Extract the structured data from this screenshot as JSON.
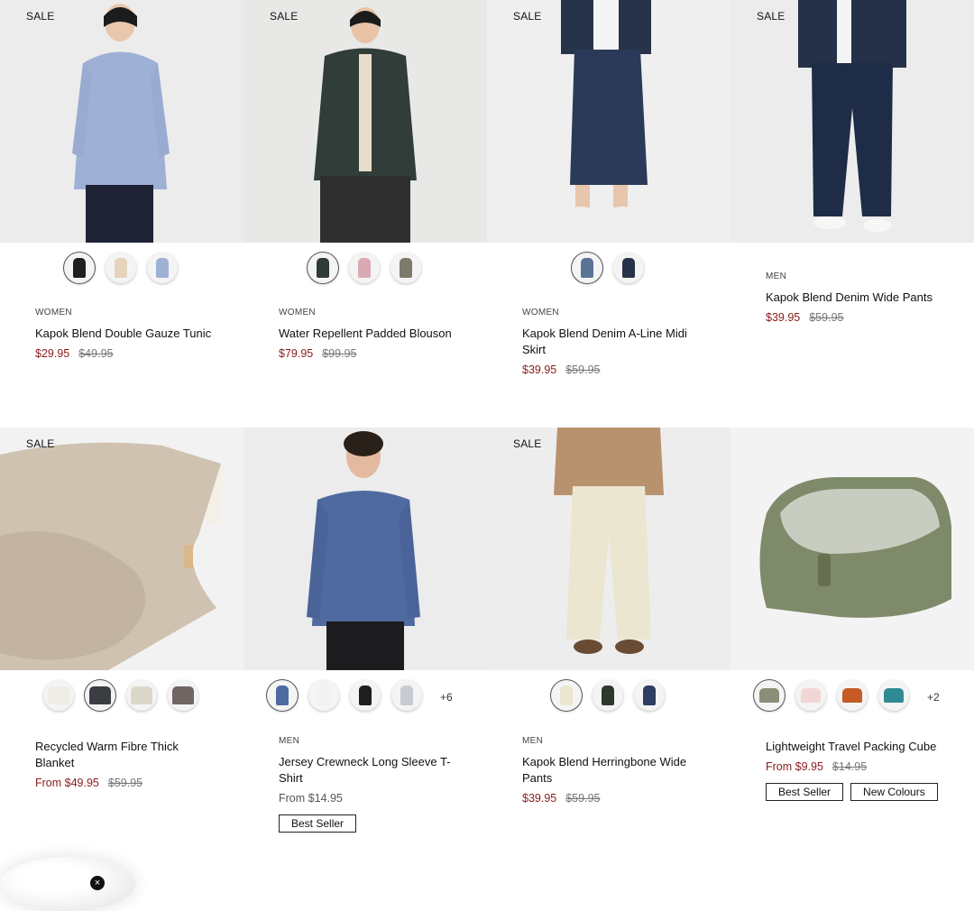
{
  "products": [
    {
      "sale": "SALE",
      "category": "WOMEN",
      "title": "Kapok Blend Double Gauze Tunic",
      "price": "$29.95",
      "was": "$49.95"
    },
    {
      "sale": "SALE",
      "category": "WOMEN",
      "title": "Water Repellent Padded Blouson",
      "price": "$79.95",
      "was": "$99.95"
    },
    {
      "sale": "SALE",
      "category": "WOMEN",
      "title": "Kapok Blend Denim A-Line Midi Skirt",
      "price": "$39.95",
      "was": "$59.95"
    },
    {
      "sale": "SALE",
      "category": "MEN",
      "title": "Kapok Blend Denim Wide Pants",
      "price": "$39.95",
      "was": "$59.95"
    },
    {
      "sale": "SALE",
      "title": "Recycled Warm Fibre Thick Blanket",
      "price": "From $49.95",
      "was": "$59.95"
    },
    {
      "category": "MEN",
      "title": "Jersey Crewneck Long Sleeve T-Shirt",
      "price": "From $14.95",
      "badge1": "Best Seller",
      "more": "+6"
    },
    {
      "sale": "SALE",
      "category": "MEN",
      "title": "Kapok Blend Herringbone Wide Pants",
      "price": "$39.95",
      "was": "$59.95"
    },
    {
      "title": "Lightweight Travel Packing Cube",
      "price": "From $9.95",
      "was": "$14.95",
      "badge1": "Best Seller",
      "badge2": "New Colours",
      "more": "+2"
    }
  ],
  "chat": {
    "close": "×"
  },
  "colors": {
    "sale_price": "#8b1a1a"
  }
}
